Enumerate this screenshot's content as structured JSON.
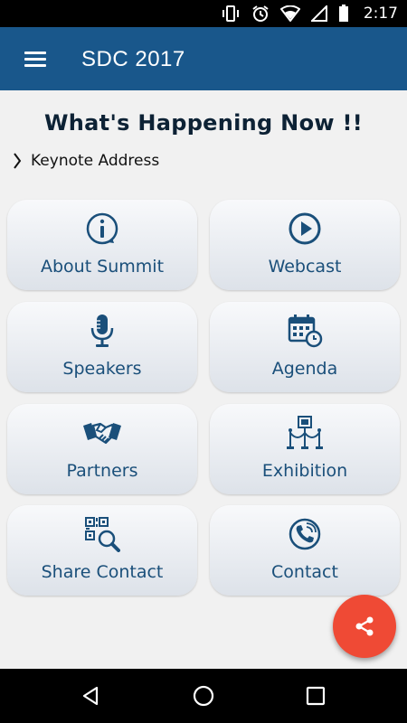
{
  "status_bar": {
    "time": "2:17"
  },
  "app_bar": {
    "title": "SDC 2017"
  },
  "happening": {
    "heading": "What's Happening Now !!",
    "item": "Keynote Address"
  },
  "tiles": [
    {
      "label": "About Summit",
      "icon": "info-icon"
    },
    {
      "label": "Webcast",
      "icon": "play-icon"
    },
    {
      "label": "Speakers",
      "icon": "microphone-icon"
    },
    {
      "label": "Agenda",
      "icon": "calendar-clock-icon"
    },
    {
      "label": "Partners",
      "icon": "handshake-icon"
    },
    {
      "label": "Exhibition",
      "icon": "exhibit-stand-icon"
    },
    {
      "label": "Share Contact",
      "icon": "qr-search-icon"
    },
    {
      "label": "Contact",
      "icon": "phone-icon"
    }
  ],
  "colors": {
    "primary": "#19578b",
    "tile_text": "#1a4f7a",
    "fab": "#ef4a35",
    "background": "#f1f1f1"
  }
}
